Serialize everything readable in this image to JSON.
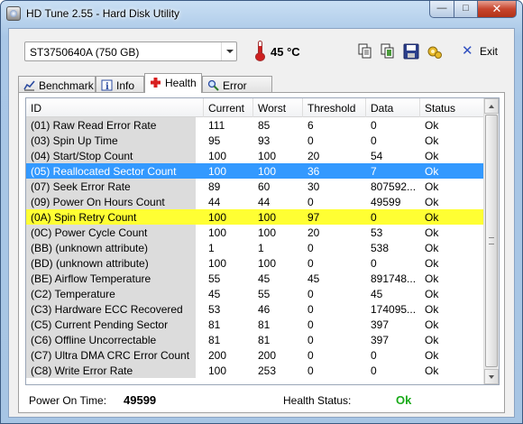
{
  "window": {
    "title": "HD Tune 2.55 - Hard Disk Utility",
    "minimize_glyph": "—",
    "maximize_glyph": "□",
    "close_glyph": "✕"
  },
  "toolbar": {
    "drive": "ST3750640A (750 GB)",
    "temperature": "45 °C",
    "exit_label": "Exit",
    "icons": [
      "copy-icon",
      "copy-all-icon",
      "save-icon",
      "options-icon",
      "exit-icon"
    ]
  },
  "tabs": [
    {
      "label": "Benchmark",
      "icon": "benchmark-icon"
    },
    {
      "label": "Info",
      "icon": "info-icon"
    },
    {
      "label": "Health",
      "icon": "health-cross-icon",
      "active": true
    },
    {
      "label": "Error Scan",
      "icon": "magnifier-icon"
    }
  ],
  "columns": [
    "ID",
    "Current",
    "Worst",
    "Threshold",
    "Data",
    "Status"
  ],
  "rows": [
    {
      "id": "(01) Raw Read Error Rate",
      "current": "111",
      "worst": "85",
      "threshold": "6",
      "data": "0",
      "status": "Ok"
    },
    {
      "id": "(03) Spin Up Time",
      "current": "95",
      "worst": "93",
      "threshold": "0",
      "data": "0",
      "status": "Ok"
    },
    {
      "id": "(04) Start/Stop Count",
      "current": "100",
      "worst": "100",
      "threshold": "20",
      "data": "54",
      "status": "Ok"
    },
    {
      "id": "(05) Reallocated Sector Count",
      "current": "100",
      "worst": "100",
      "threshold": "36",
      "data": "7",
      "status": "Ok",
      "state": "selected"
    },
    {
      "id": "(07) Seek Error Rate",
      "current": "89",
      "worst": "60",
      "threshold": "30",
      "data": "807592...",
      "status": "Ok"
    },
    {
      "id": "(09) Power On Hours Count",
      "current": "44",
      "worst": "44",
      "threshold": "0",
      "data": "49599",
      "status": "Ok"
    },
    {
      "id": "(0A) Spin Retry Count",
      "current": "100",
      "worst": "100",
      "threshold": "97",
      "data": "0",
      "status": "Ok",
      "state": "warning"
    },
    {
      "id": "(0C) Power Cycle Count",
      "current": "100",
      "worst": "100",
      "threshold": "20",
      "data": "53",
      "status": "Ok"
    },
    {
      "id": "(BB) (unknown attribute)",
      "current": "1",
      "worst": "1",
      "threshold": "0",
      "data": "538",
      "status": "Ok"
    },
    {
      "id": "(BD) (unknown attribute)",
      "current": "100",
      "worst": "100",
      "threshold": "0",
      "data": "0",
      "status": "Ok"
    },
    {
      "id": "(BE) Airflow Temperature",
      "current": "55",
      "worst": "45",
      "threshold": "45",
      "data": "891748...",
      "status": "Ok"
    },
    {
      "id": "(C2) Temperature",
      "current": "45",
      "worst": "55",
      "threshold": "0",
      "data": "45",
      "status": "Ok"
    },
    {
      "id": "(C3) Hardware ECC Recovered",
      "current": "53",
      "worst": "46",
      "threshold": "0",
      "data": "174095...",
      "status": "Ok"
    },
    {
      "id": "(C5) Current Pending Sector",
      "current": "81",
      "worst": "81",
      "threshold": "0",
      "data": "397",
      "status": "Ok"
    },
    {
      "id": "(C6) Offline Uncorrectable",
      "current": "81",
      "worst": "81",
      "threshold": "0",
      "data": "397",
      "status": "Ok"
    },
    {
      "id": "(C7) Ultra DMA CRC Error Count",
      "current": "200",
      "worst": "200",
      "threshold": "0",
      "data": "0",
      "status": "Ok"
    },
    {
      "id": "(C8) Write Error Rate",
      "current": "100",
      "worst": "253",
      "threshold": "0",
      "data": "0",
      "status": "Ok"
    }
  ],
  "footer": {
    "power_on_label": "Power On Time:",
    "power_on_value": "49599",
    "health_label": "Health Status:",
    "health_value": "Ok",
    "health_color": "#1aaa1a"
  },
  "colors": {
    "selected_row": "#3399ff",
    "warning_row": "#ffff33"
  }
}
